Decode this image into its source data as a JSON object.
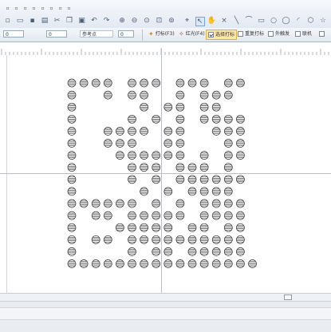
{
  "toolbar": {
    "origin_x_value": "0",
    "origin_y_value": "0",
    "step_value": "0",
    "reference_label": "参考点",
    "zoom_value": "0"
  },
  "modes": {
    "mark_label": "打标(F3)",
    "red_light_label": "红光(F4)",
    "select_mark_label": "选择打标",
    "repeat_mark_label": "重复打标",
    "external_trigger_label": "外触发",
    "online_label": "联机"
  },
  "state": {
    "select_mark_checked": true,
    "repeat_mark_checked": false,
    "external_trigger_checked": false,
    "online_checked": false
  },
  "icons": {
    "toolbar_row1": [
      "new-icon",
      "open-icon",
      "save-icon",
      "print-icon",
      "cut-icon",
      "copy-icon",
      "paste-icon",
      "undo-icon",
      "redo-icon",
      "zoom-in-icon",
      "zoom-out-icon",
      "zoom-fit-icon",
      "zoom-window-icon",
      "zoom-100-icon",
      "node-edit-icon",
      "select-arrow-icon",
      "pan-hand-icon",
      "point-icon",
      "line-icon",
      "polyline-icon",
      "rectangle-icon",
      "circle-icon",
      "ellipse-icon",
      "arc-icon",
      "polygon-icon",
      "star-icon"
    ]
  },
  "colors": {
    "guide": "#b9bec6",
    "dot_stroke": "#2b2b2b"
  },
  "dot_grid": {
    "columns": 16,
    "rows": 16,
    "rows_pattern": [
      "1111011101110110",
      "1001011001011100",
      "1000001011011000",
      "1000010101011110",
      "1001111011001110",
      "1001110011000110",
      "1000111111010110",
      "1000011101110100",
      "1000010101111110",
      "1000001010111100",
      "1111110101011110",
      "1011011111011110",
      "1000111110110110",
      "1011011111111110",
      "1000010110111110",
      "1111111111111111"
    ]
  }
}
